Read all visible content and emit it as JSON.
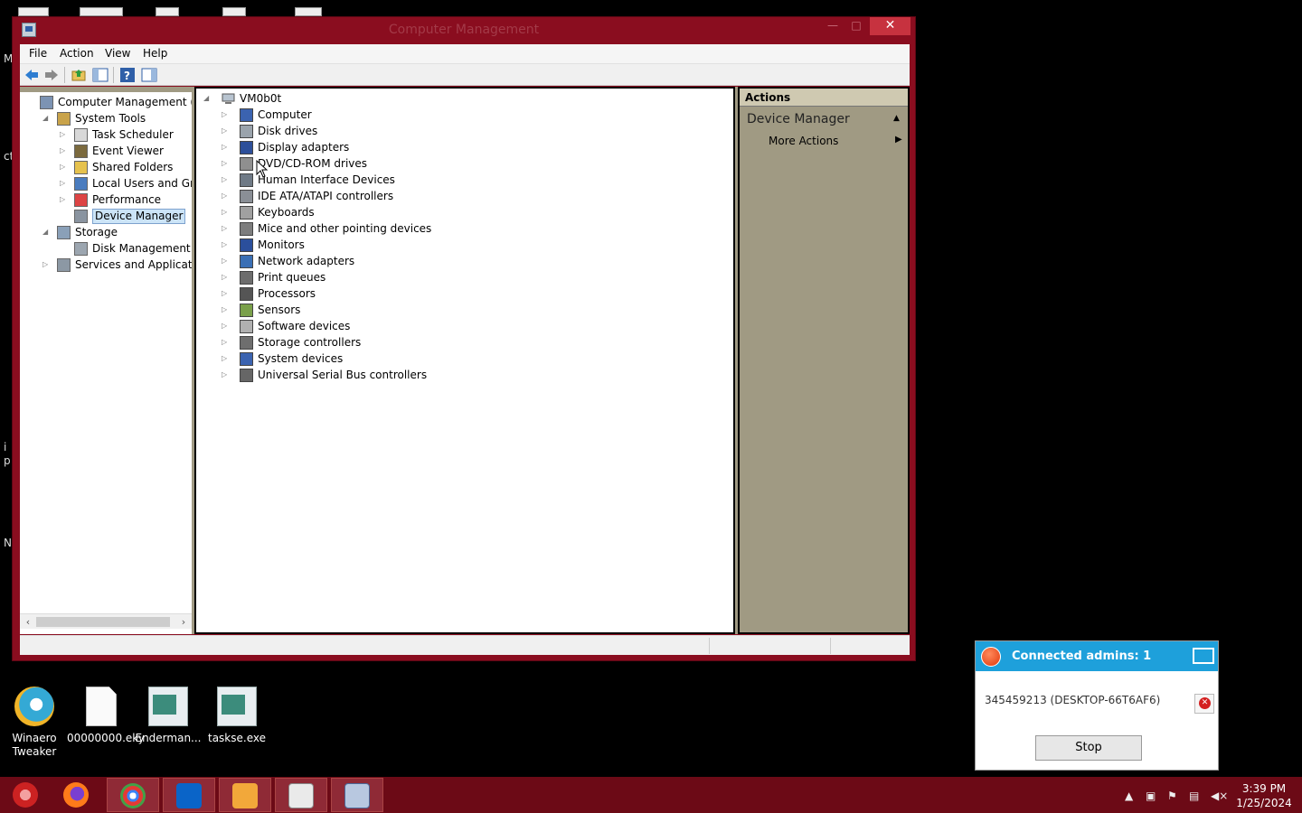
{
  "window": {
    "title": "Computer Management",
    "minimize": "—",
    "maximize": "□",
    "close": "✕"
  },
  "menu": [
    "File",
    "Action",
    "View",
    "Help"
  ],
  "left_tree": [
    {
      "label": "Computer Management (Local",
      "icon": "computer-management-icon",
      "expander": "",
      "indent": 0
    },
    {
      "label": "System Tools",
      "icon": "system-tools-icon",
      "expander": "◢",
      "indent": 1
    },
    {
      "label": "Task Scheduler",
      "icon": "clock-icon",
      "expander": "▷",
      "indent": 2
    },
    {
      "label": "Event Viewer",
      "icon": "event-viewer-icon",
      "expander": "▷",
      "indent": 2
    },
    {
      "label": "Shared Folders",
      "icon": "shared-folder-icon",
      "expander": "▷",
      "indent": 2
    },
    {
      "label": "Local Users and Groups",
      "icon": "users-icon",
      "expander": "▷",
      "indent": 2
    },
    {
      "label": "Performance",
      "icon": "performance-icon",
      "expander": "▷",
      "indent": 2
    },
    {
      "label": "Device Manager",
      "icon": "device-manager-icon",
      "expander": "",
      "indent": 2,
      "selected": true
    },
    {
      "label": "Storage",
      "icon": "storage-icon",
      "expander": "◢",
      "indent": 1
    },
    {
      "label": "Disk Management",
      "icon": "disk-management-icon",
      "expander": "",
      "indent": 2
    },
    {
      "label": "Services and Applications",
      "icon": "services-icon",
      "expander": "▷",
      "indent": 1
    }
  ],
  "device_tree": {
    "root": "VM0b0t",
    "root_expander": "◢",
    "categories": [
      {
        "label": "Computer",
        "icon": "computer-icon"
      },
      {
        "label": "Disk drives",
        "icon": "disk-drive-icon"
      },
      {
        "label": "Display adapters",
        "icon": "display-adapter-icon"
      },
      {
        "label": "DVD/CD-ROM drives",
        "icon": "dvd-drive-icon"
      },
      {
        "label": "Human Interface Devices",
        "icon": "hid-icon"
      },
      {
        "label": "IDE ATA/ATAPI controllers",
        "icon": "ide-controller-icon"
      },
      {
        "label": "Keyboards",
        "icon": "keyboard-icon"
      },
      {
        "label": "Mice and other pointing devices",
        "icon": "mouse-icon"
      },
      {
        "label": "Monitors",
        "icon": "monitor-icon"
      },
      {
        "label": "Network adapters",
        "icon": "network-adapter-icon"
      },
      {
        "label": "Print queues",
        "icon": "printer-icon"
      },
      {
        "label": "Processors",
        "icon": "processor-icon"
      },
      {
        "label": "Sensors",
        "icon": "sensor-icon"
      },
      {
        "label": "Software devices",
        "icon": "software-device-icon"
      },
      {
        "label": "Storage controllers",
        "icon": "storage-controller-icon"
      },
      {
        "label": "System devices",
        "icon": "system-device-icon"
      },
      {
        "label": "Universal Serial Bus controllers",
        "icon": "usb-icon"
      }
    ]
  },
  "actions": {
    "header": "Actions",
    "section": "Device Manager",
    "more": "More Actions"
  },
  "desktop_icons": [
    {
      "label": "Winaero\nTweaker",
      "icon": "winaero-tweaker-icon"
    },
    {
      "label": "00000000.eky",
      "icon": "file-icon"
    },
    {
      "label": "Enderman...",
      "icon": "window-file-icon"
    },
    {
      "label": "taskse.exe",
      "icon": "window-file-icon"
    }
  ],
  "admin_popup": {
    "title": "Connected admins: 1",
    "entry": "345459213 (DESKTOP-66T6AF6)",
    "stop": "Stop"
  },
  "taskbar": {
    "apps": [
      "pinwheel-icon",
      "firefox-icon",
      "chrome-icon",
      "outlook-icon",
      "folder-app-icon",
      "hxd-icon",
      "computer-management-icon"
    ],
    "time": "3:39 PM",
    "date": "1/25/2024"
  },
  "colors": {
    "window_frame": "#8a0d1f",
    "taskbar": "#6c0a16",
    "actions_bg": "#a09a83",
    "popup_header": "#1ea0db"
  }
}
